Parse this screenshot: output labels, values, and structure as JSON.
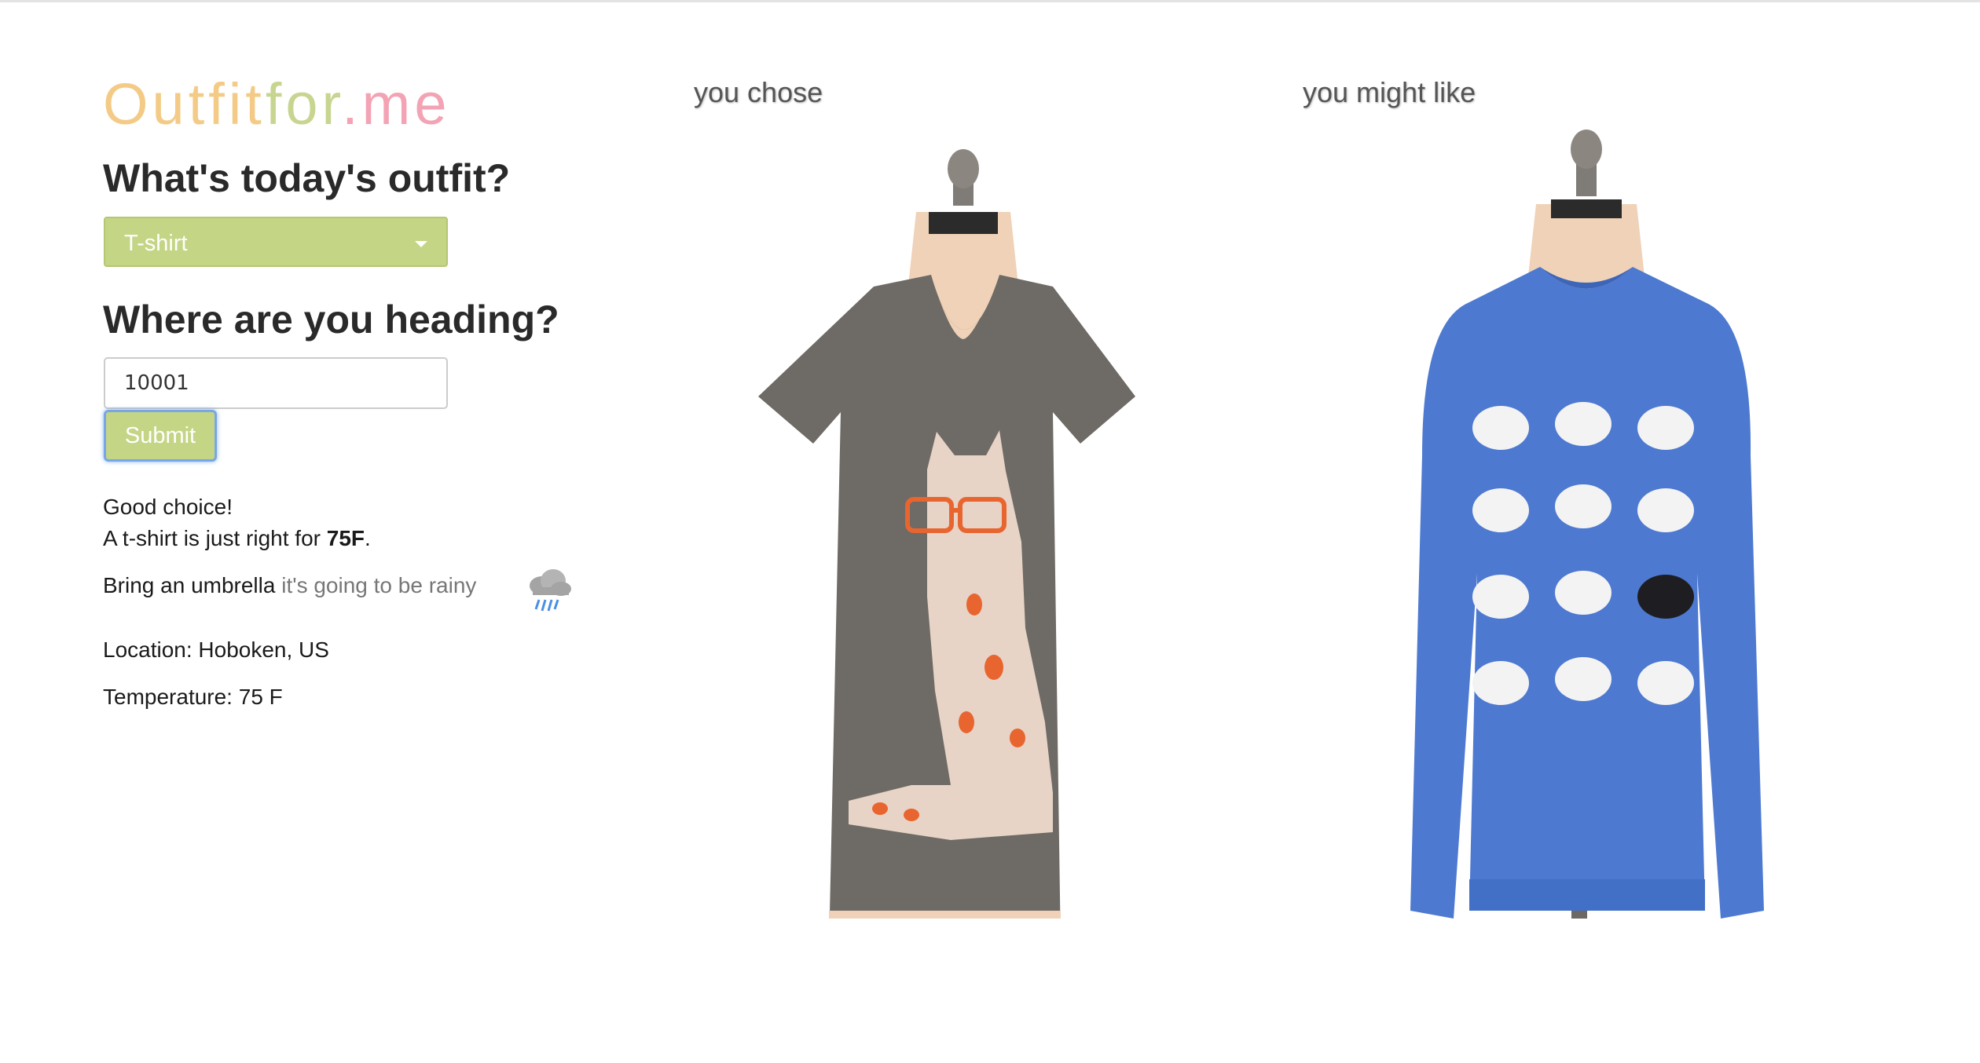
{
  "brand": {
    "part1": "Outfit",
    "part2": "for",
    "part3": ".me"
  },
  "form": {
    "outfit_question": "What's today's outfit?",
    "outfit_selected": "T-shirt",
    "destination_question": "Where are you heading?",
    "zip_value": "10001",
    "submit_label": "Submit"
  },
  "result": {
    "line1": "Good choice!",
    "line2_prefix": "A t-shirt is just right for ",
    "line2_temp": "75F",
    "line2_suffix": ".",
    "umbrella_main": "Bring an umbrella",
    "umbrella_note": "it's going to be rainy",
    "location": "Location: Hoboken, US",
    "temperature": "Temperature: 75 F",
    "weather_icon": "rain-cloud-icon"
  },
  "columns": {
    "chosen_title": "you chose",
    "suggest_title": "you might like"
  },
  "colors": {
    "accent_green": "#c4d585",
    "logo_orange": "#f3cb86",
    "logo_green": "#c7d591",
    "logo_pink": "#f3a3b4",
    "tee_gray": "#6e6a65",
    "sweater_blue": "#4d79d0"
  }
}
